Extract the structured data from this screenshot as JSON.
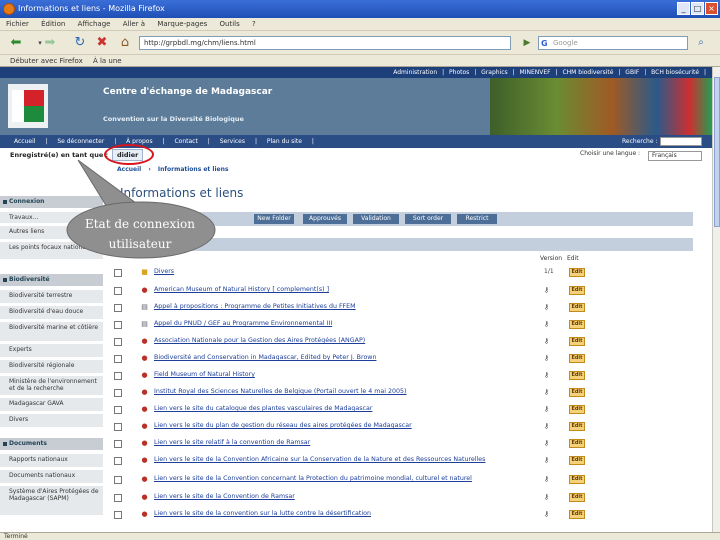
{
  "window": {
    "title": "Informations et liens - Mozilla Firefox",
    "controls": [
      "_",
      "□",
      "×"
    ]
  },
  "menu": [
    "Fichier",
    "Édition",
    "Affichage",
    "Aller à",
    "Marque-pages",
    "Outils",
    "?"
  ],
  "nav": {
    "url": "http://grpbdl.mg/chm/liens.html",
    "search_placeholder": "Google"
  },
  "bookmarks": [
    "Débuter avec Firefox",
    "À la une"
  ],
  "site": {
    "toplinks": [
      "Administration",
      "|",
      "Photos",
      "|",
      "Graphics",
      "|",
      "MINENVEF",
      "|",
      "CHM biodiversité",
      "|",
      "GBIF",
      "|",
      "BCH biosécurité",
      "|"
    ],
    "banner_title": "Centre d'échange de Madagascar",
    "banner_subtitle": "Convention sur la Diversité Biologique",
    "nav": [
      "Accueil",
      "|",
      "Se déconnecter",
      "|",
      "À propos",
      "|",
      "Contact",
      "|",
      "Services",
      "|",
      "Plan du site",
      "|"
    ],
    "search_label": "Recherche :",
    "logged_in_label": "Enregistré(e) en tant que :",
    "username": "didier",
    "choose_language": "Choisir une langue :",
    "language": "Français",
    "breadcrumb": [
      "Accueil",
      "›",
      "Informations et liens"
    ]
  },
  "sidebar": {
    "sections": [
      {
        "head": "Connexion",
        "items": [
          "Travaux...",
          "Autres liens",
          "Les points focaux nationaux"
        ]
      },
      {
        "head": "Biodiversité",
        "items": [
          "Biodiversité terrestre",
          "Biodiversité d'eau douce",
          "Biodiversité marine et côtière",
          "Experts",
          "Biodiversité régionale",
          "Ministère de l'environnement et de la recherche",
          "Madagascar GAVA",
          "Divers"
        ]
      },
      {
        "head": "Documents",
        "items": [
          "Rapports nationaux",
          "Documents nationaux",
          "Système d'Aires Protégées de Madagascar (SAPM)"
        ]
      }
    ]
  },
  "main": {
    "title": "Informations et liens",
    "actions": [
      "New Folder",
      "Approuvés",
      "Validation",
      "Sort order",
      "Restrict"
    ],
    "columns": {
      "version": "Version",
      "edit": "Edit"
    },
    "rows": [
      {
        "label": "Divers",
        "icon": "folder-icon",
        "version": "1/1",
        "edit": "Edit"
      },
      {
        "label": "American Museum of Natural History [ complement(s) ]",
        "icon": "link-icon",
        "version": "",
        "edit": "Edit"
      },
      {
        "label": "Appel à propositions : Programme de Petites Initiatives du FFEM",
        "icon": "doc-icon",
        "version": "",
        "edit": "Edit"
      },
      {
        "label": "Appel du PNUD / GEF au Programme Environnemental III",
        "icon": "doc-icon",
        "version": "",
        "edit": "Edit"
      },
      {
        "label": "Association Nationale pour la Gestion des Aires Protégées (ANGAP)",
        "icon": "link-icon",
        "version": "",
        "edit": "Edit"
      },
      {
        "label": "Biodiversité and Conservation in Madagascar, Edited by Peter J. Brown",
        "icon": "link-icon",
        "version": "",
        "edit": "Edit"
      },
      {
        "label": "Field Museum of Natural History",
        "icon": "link-icon",
        "version": "",
        "edit": "Edit"
      },
      {
        "label": "Institut Royal des Sciences Naturelles de Belgique (Portail ouvert le 4 mai 2005)",
        "icon": "link-icon",
        "version": "",
        "edit": "Edit"
      },
      {
        "label": "Lien vers le site du catalogue des plantes vasculaires de Madagascar",
        "icon": "link-icon",
        "version": "",
        "edit": "Edit"
      },
      {
        "label": "Lien vers le site du plan de gestion du réseau des aires protégées de Madagascar",
        "icon": "link-icon",
        "version": "",
        "edit": "Edit"
      },
      {
        "label": "Lien vers le site relatif à la convention de Ramsar",
        "icon": "link-icon",
        "version": "",
        "edit": "Edit"
      },
      {
        "label": "Lien vers le site de la Convention Africaine sur la Conservation de la Nature et des Ressources Naturelles",
        "icon": "link-icon",
        "version": "",
        "edit": "Edit"
      },
      {
        "label": "Lien vers le site de la Convention concernant la Protection du patrimoine mondial, culturel et naturel",
        "icon": "link-icon",
        "version": "",
        "edit": "Edit"
      },
      {
        "label": "Lien vers le site de la Convention de Ramsar",
        "icon": "link-icon",
        "version": "",
        "edit": "Edit"
      },
      {
        "label": "Lien vers le site de la convention sur la lutte contre la désertification",
        "icon": "link-icon",
        "version": "",
        "edit": "Edit"
      }
    ]
  },
  "status": "Terminé",
  "callout": [
    "Etat de connexion",
    "utilisateur"
  ],
  "colors": {
    "highlight": "#d8141d",
    "callout_fill": "#8f8f8f",
    "nav_blue": "#2a4d86"
  }
}
